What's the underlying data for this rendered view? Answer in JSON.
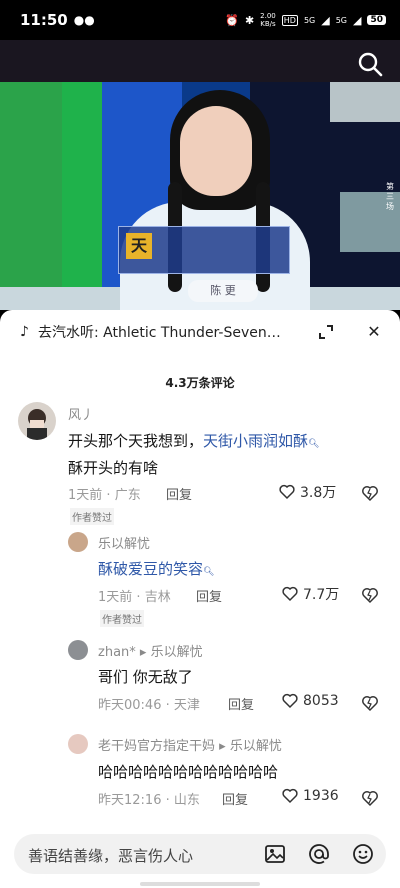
{
  "status_bar": {
    "time": "11:50",
    "net_speed_value": "2.00",
    "net_speed_unit": "KB/s",
    "hd_badge": "HD",
    "signal_1": "5G",
    "signal_2": "5G",
    "battery": "50",
    "icons": [
      "wechat-icon",
      "alarm-icon",
      "bluetooth-icon",
      "wifi-icon"
    ]
  },
  "video": {
    "nameplate_char": "天",
    "badge_text": "陈 更",
    "side_label": "第三场"
  },
  "music": {
    "label": "去汽水听: Athletic Thunder-Seven…"
  },
  "comments_count": "4.3万条评论",
  "comments": [
    {
      "name": "风丿",
      "text_plain_1": "开头那个天我想到，",
      "text_highlight": "天街小雨润如酥",
      "text_line_2": "酥开头的有啥",
      "time": "1天前",
      "location": "广东",
      "reply_label": "回复",
      "likes": "3.8万",
      "author_tag": "作者赞过"
    },
    {
      "name": "乐以解忧",
      "text_highlight": "酥破爱豆的笑容",
      "time": "1天前",
      "location": "吉林",
      "reply_label": "回复",
      "likes": "7.7万",
      "author_tag": "作者赞过"
    },
    {
      "name": "zhan*",
      "reply_to": "乐以解忧",
      "text": "哥们 你无敌了",
      "time": "昨天00:46",
      "location": "天津",
      "reply_label": "回复",
      "likes": "8053"
    },
    {
      "name": "老干妈官方指定干妈",
      "reply_to": "乐以解忧",
      "text": "哈哈哈哈哈哈哈哈哈哈哈哈",
      "time": "昨天12:16",
      "location": "山东",
      "reply_label": "回复",
      "likes": "1936"
    }
  ],
  "input": {
    "placeholder": "善语结善缘，恶言伤人心"
  },
  "colors": {
    "highlight": "#2f58a8",
    "meta_gray": "#9a9a9a"
  }
}
